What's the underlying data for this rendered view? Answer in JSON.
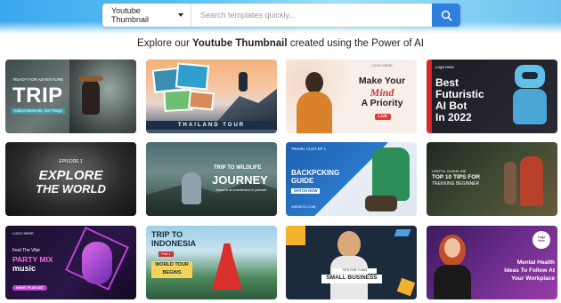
{
  "search": {
    "category": "Youtube Thumbnail",
    "placeholder": "Search templates quickly..."
  },
  "headline": {
    "prefix": "Explore our ",
    "highlight": "Youtube Thumbnail",
    "suffix": " created using the Power of AI"
  },
  "cards": [
    {
      "small_top": "READY FOR ADVENTURE",
      "big": "TRIP",
      "small_bottom": "Collect Moments, Not Things"
    },
    {
      "banner": "THAILAND TOUR"
    },
    {
      "logo": "LOGO HERE",
      "line1": "Make Your",
      "line2": "Mind",
      "line3": "A Priority",
      "badge": "LIVE"
    },
    {
      "logo": "Logo Here",
      "line1": "Best",
      "line2": "Futuristic",
      "line3": "AI Bot",
      "line4": "In 2022"
    },
    {
      "small": "EPISODE 1",
      "line1": "EXPLORE",
      "line2": "THE WORLD"
    },
    {
      "line1": "TRIP TO WILDLIFE",
      "line2": "JOURNEY",
      "small": "Travel is an investment in yourself"
    },
    {
      "small": "TRAVEL VLOG EP 1",
      "line1": "BACKPCKING",
      "line2": "GUIDE",
      "button": "WATCH NOW",
      "url": "WEBSITE.COM"
    },
    {
      "small": "USEFUL GUIDELINE",
      "line1": "TOP 10 TIPS FOR",
      "line2": "TREKKING BEGINNER"
    },
    {
      "logo": "LOGO HERE",
      "small": "Feel The Vibe",
      "line1": "PARTY MIX",
      "line2": "music",
      "button": "NIGHT PLAYLIST"
    },
    {
      "line1": "TRIP TO",
      "line2": "INDONESIA",
      "small": "Part 1",
      "line3": "WORLD TOUR",
      "line4": "BEGINS"
    },
    {
      "small": "TIPS FOR YOUR",
      "line1": "SMALL BUSINESS"
    },
    {
      "logo": "Logo Here",
      "line1": "Mental Health",
      "line2": "Ideas To Follow At",
      "line3": "Your Workplace"
    }
  ],
  "colors": {
    "accent": "#2f7fe0"
  }
}
